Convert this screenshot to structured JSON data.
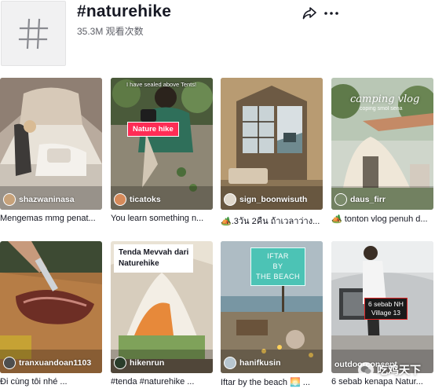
{
  "header": {
    "avatar_icon": "hashtag-icon",
    "title": "#naturehike",
    "views": "35.3M 观看次数",
    "share_icon": "share-arrow-icon",
    "more_icon": "more-horizontal-icon"
  },
  "videos": [
    {
      "username": "shazwaninasa",
      "caption": "Mengemas mmg penat..."
    },
    {
      "username": "ticatoks",
      "caption": "You learn something n...",
      "overlay_top": "I have sealed above Tents!",
      "tag": "Nature hike"
    },
    {
      "username": "sign_boonwisuth",
      "caption": "🏕️.3วัน 2คืน ถ้าเวลาว่าง..."
    },
    {
      "username": "daus_firr",
      "caption": "🏕️ tonton vlog penuh d...",
      "overlay_title": "camping vlog",
      "overlay_sub": "coping smol sena"
    },
    {
      "username": "tranxuandoan1103",
      "caption": "Đi cùng tôi nhé ..."
    },
    {
      "username": "hikenrun",
      "caption": "#tenda #naturehike ...",
      "overlay_line1": "Tenda Mevvah dari",
      "overlay_line2": "Naturehike"
    },
    {
      "username": "hanifkusin",
      "caption": "Iftar by the beach 🌅 ...",
      "overlay_line1": "IFTAR",
      "overlay_line2": "BY",
      "overlay_line3": "THE BEACH"
    },
    {
      "username": "outdoorconcept",
      "caption": "6 sebab kenapa Natur...",
      "overlay_line1": "6 sebab NH",
      "overlay_line2": "Village 13"
    }
  ],
  "watermark": {
    "text": "吃鸡天下",
    "icon": "wechat-icon"
  },
  "colors": {
    "tag_red": "#fe2c55",
    "teal": "#4cc3b5",
    "text_primary": "#161823",
    "text_secondary": "#5c5e66"
  }
}
